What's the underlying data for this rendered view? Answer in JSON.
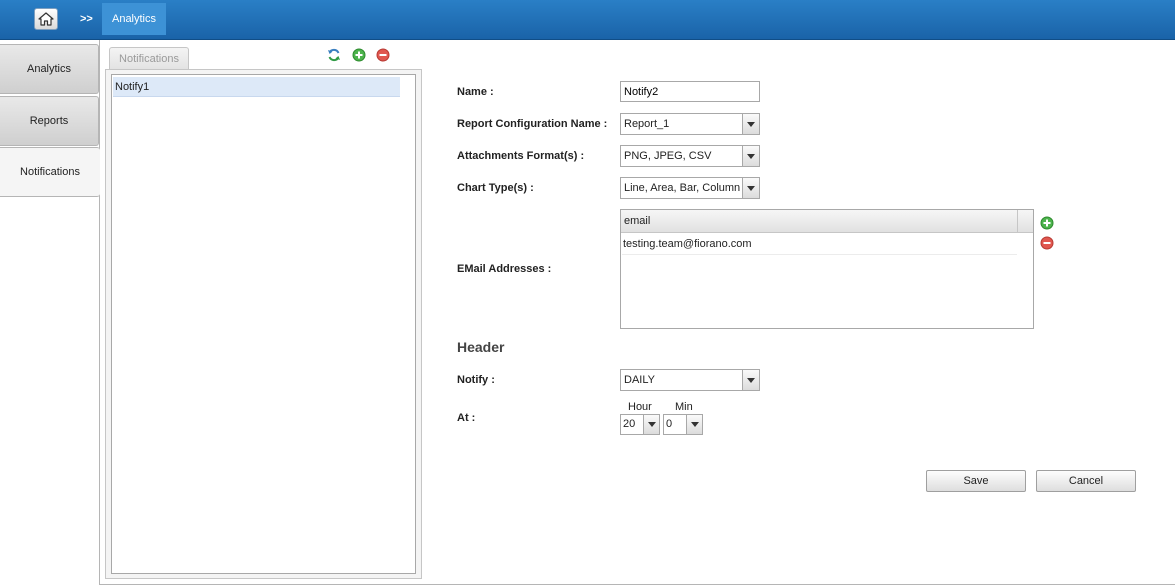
{
  "header": {
    "home_icon": "home-icon",
    "separator": ">>",
    "active_crumb": "Analytics"
  },
  "leftnav": {
    "items": [
      {
        "label": "Analytics"
      },
      {
        "label": "Reports"
      },
      {
        "label": "Notifications",
        "active": true
      }
    ]
  },
  "notifications_panel": {
    "tab_label": "Notifications",
    "toolbar_icons": [
      "refresh-icon",
      "add-icon",
      "remove-icon"
    ],
    "items": [
      "Notify1"
    ]
  },
  "form": {
    "name_label": "Name :",
    "name_value": "Notify2",
    "report_config_label": "Report Configuration Name :",
    "report_config_value": "Report_1",
    "attachments_label": "Attachments Format(s) :",
    "attachments_value": "PNG, JPEG, CSV",
    "chart_types_label": "Chart Type(s) :",
    "chart_types_value": "Line, Area, Bar, Column",
    "email_label": "EMail Addresses :",
    "email_column_header": "email",
    "emails": [
      "testing.team@fiorano.com"
    ],
    "section_header": "Header",
    "notify_label": "Notify :",
    "notify_value": "DAILY",
    "at_label": "At :",
    "hour_label": "Hour",
    "min_label": "Min",
    "hour_value": "20",
    "min_value": "0"
  },
  "buttons": {
    "save": "Save",
    "cancel": "Cancel"
  },
  "colors": {
    "topbar": "#1f6fb5",
    "active_crumb": "#3d92d6",
    "selected_row": "#dde9f8",
    "add_icon": "#3aa63a",
    "remove_icon": "#d9413a"
  }
}
